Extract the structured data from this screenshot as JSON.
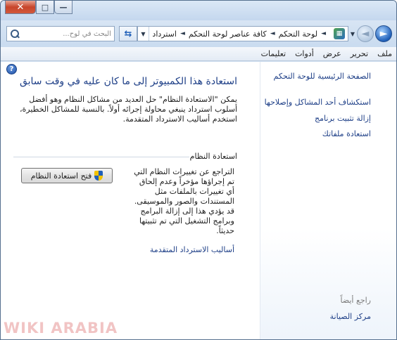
{
  "window": {
    "buttons": {
      "close": "✕",
      "maximize": "□",
      "minimize": "—"
    }
  },
  "nav": {
    "back_arrow": "◄",
    "forward_arrow": "►",
    "dropdown": "▼"
  },
  "address": {
    "crumbs": [
      "لوحة التحكم",
      "كافة عناصر لوحة التحكم",
      "استرداد"
    ],
    "separator": "◄",
    "dropdown": "▼"
  },
  "refresh": {
    "glyph": "⇆"
  },
  "search": {
    "placeholder": "البحث في لوح..."
  },
  "menubar": {
    "items": [
      "ملف",
      "تحرير",
      "عرض",
      "أدوات",
      "تعليمات"
    ]
  },
  "sidebar": {
    "links": [
      "الصفحة الرئيسية للوحة التحكم",
      "استكشاف أحد المشاكل وإصلاحها",
      "إزالة تثبيت برنامج",
      "استعادة ملفاتك"
    ],
    "see_also_title": "راجع أيضاً",
    "see_also_links": [
      "مركز الصيانة"
    ]
  },
  "help": {
    "glyph": "?"
  },
  "main": {
    "title": "استعادة هذا الكمبيوتر إلى ما كان عليه في وقت سابق",
    "description": "يمكن \"الاستعادة النظام\" حل العديد من مشاكل النظام وهو أفضل أسلوب استرداد ينبغي محاولة إجرائه أولاً. بالنسبة للمشاكل الخطيرة، استخدم أساليب الاسترداد المتقدمة.",
    "section_title": "استعادة النظام",
    "restore_description": "التراجع عن تغييرات النظام التي تم إجراؤها مؤخراً وعدم إلحاق أي تغييرات بالملفات مثل المستندات والصور والموسيقى. قد يؤدي هذا إلى إزالة البرامج وبرامج التشغيل التي تم تثبيتها حديثاً.",
    "restore_button": "فتح استعادة النظام",
    "advanced_link": "أساليب الاسترداد المتقدمة"
  },
  "watermark": "WIKI ARABIA",
  "colors": {
    "link": "#1e3f87",
    "frame": "#cfdff0",
    "close": "#c7452b"
  }
}
